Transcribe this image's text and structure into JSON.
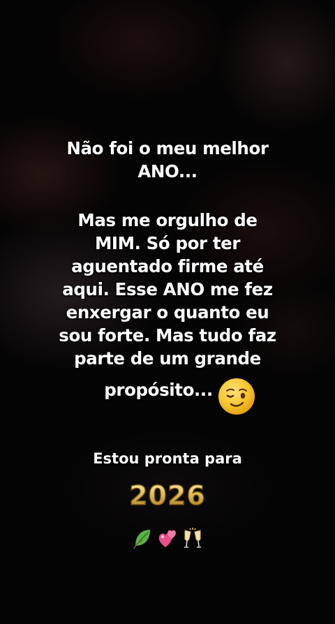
{
  "message": {
    "lines_part1": [
      "Não foi o meu melhor",
      "ANO..."
    ],
    "lines_part2": [
      "Mas me orgulho de",
      "MIM. Só por ter",
      "aguentado firme até",
      "aqui. Esse ANO me fez",
      "enxergar o quanto eu",
      "sou forte. Mas tudo faz",
      "parte de um grande"
    ],
    "last_line": "propósito...",
    "closing": "Estou pronta para",
    "year": "2026"
  },
  "icons": {
    "after_last_line": "winking-face-emoji",
    "row": [
      "leaf-emoji",
      "two-hearts-emoji",
      "clinking-glasses-emoji"
    ]
  },
  "colors": {
    "text": "#ffffff",
    "background": "#050404",
    "balloon_gold": "#d9b24a",
    "emoji_yellow": "#f7c52b",
    "heart_pink": "#e8508a",
    "leaf_green": "#5bb445"
  }
}
